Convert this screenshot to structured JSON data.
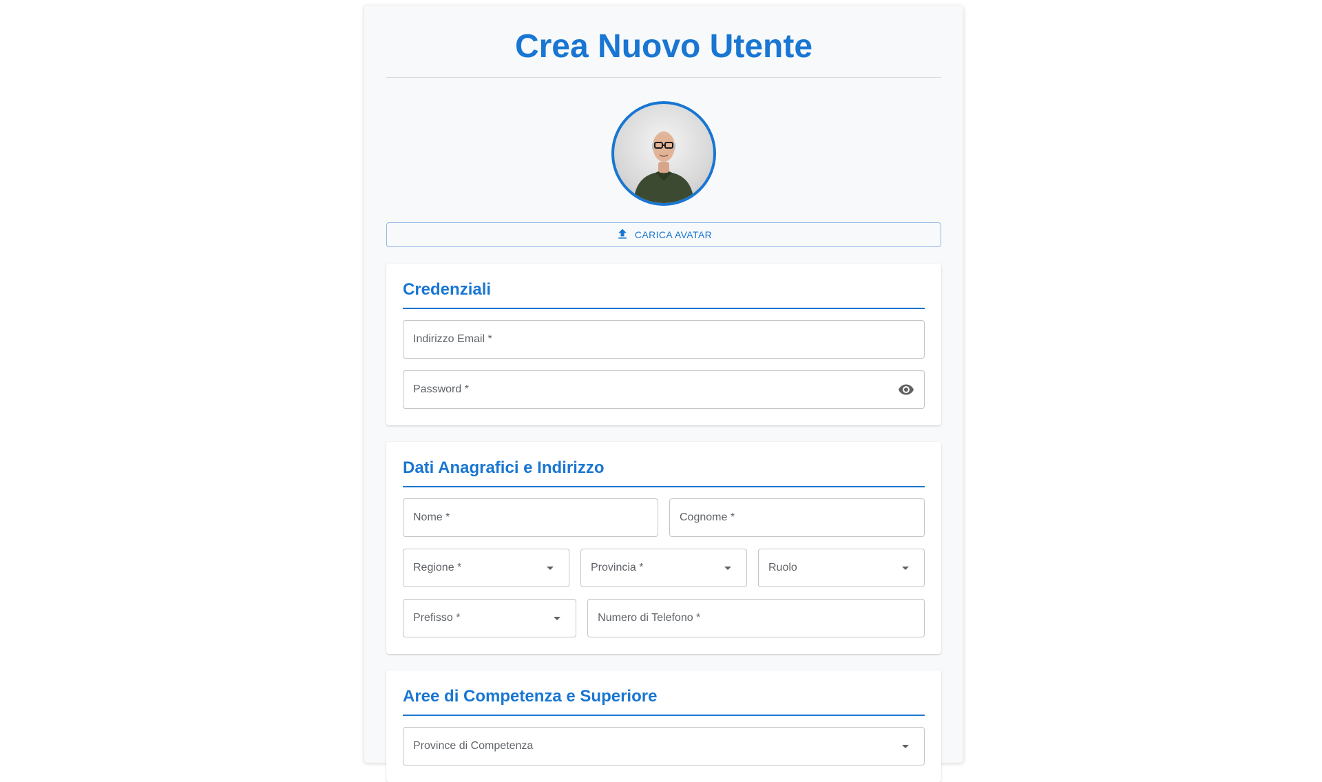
{
  "page": {
    "title": "Crea Nuovo Utente"
  },
  "avatar": {
    "upload_label": "CARICA AVATAR",
    "upload_icon": "upload-icon"
  },
  "credentials": {
    "title": "Credenziali",
    "email_label": "Indirizzo Email *",
    "password_label": "Password *",
    "password_toggle_icon": "eye-icon"
  },
  "personal": {
    "title": "Dati Anagrafici e Indirizzo",
    "first_name_label": "Nome *",
    "last_name_label": "Cognome *",
    "region_label": "Regione *",
    "province_label": "Provincia *",
    "role_label": "Ruolo",
    "prefix_label": "Prefisso *",
    "phone_label": "Numero di Telefono *"
  },
  "competence": {
    "title": "Aree di Competenza e Superiore",
    "provinces_label": "Province di Competenza"
  },
  "colors": {
    "accent": "#1976d2",
    "panel_bg": "#f7f9fb",
    "border": "#c4c4c4"
  }
}
